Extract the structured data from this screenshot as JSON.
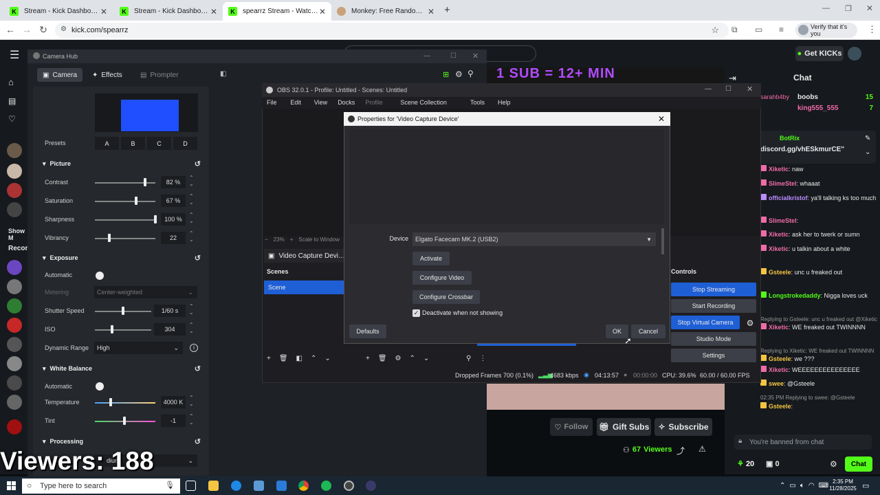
{
  "browser": {
    "tabs": [
      {
        "label": "Stream - Kick Dashboard",
        "active": false
      },
      {
        "label": "Stream - Kick Dashboard",
        "active": false
      },
      {
        "label": "spearrz Stream - Watch Live on",
        "active": true
      },
      {
        "label": "Monkey: Free Random Video C",
        "active": false
      }
    ],
    "url": "kick.com/spearrz",
    "verify_label": "Verify that it's you"
  },
  "kick": {
    "get_kicks": "Get KICKs",
    "sub_banner": "1 SUB = 12+ MIN",
    "chat_title": "Chat",
    "top_gifters": [
      {
        "name": "boobs",
        "count": "15"
      },
      {
        "name": "king555_555",
        "count": "7"
      }
    ],
    "partial_user": "sarahb4by",
    "pinned_user": "BotRix",
    "pinned_text": "discord.gg/vhESkmurCE\"",
    "chat_messages": [
      {
        "user": "Xiketic",
        "text": ": naw",
        "color": "#f06ba8"
      },
      {
        "user": "SlimeStel",
        "text": ": whaaat",
        "color": "#f06ba8"
      },
      {
        "user": "officialkristof",
        "text": ": ya'll talking ks too much",
        "color": "#b98cff"
      },
      {
        "user": "SlimeStel",
        "text": ": ",
        "color": "#f06ba8"
      },
      {
        "user": "Xiketic",
        "text": ": ask her to twerk or sumn",
        "color": "#f06ba8"
      },
      {
        "user": "Xiketic",
        "text": ": u talkin about a white",
        "color": "#f06ba8"
      },
      {
        "user": "Gsteele",
        "text": ": unc u freaked out",
        "color": "#f5c542"
      },
      {
        "user": "Longstrokedaddy",
        "text": ": Nigga loves uck",
        "color": "#53fc18"
      },
      {
        "user": "",
        "text": "Replying to Gsteele: unc u freaked out @Xiketic",
        "color": "#999"
      },
      {
        "user": "Xiketic",
        "text": ": WE freaked out TWINNNN",
        "color": "#f06ba8"
      },
      {
        "user": "",
        "text": "Replying to Xiketic: WE freaked out TWINNNN",
        "color": "#999"
      },
      {
        "user": "Gsteele",
        "text": ": we ???",
        "color": "#f5c542"
      },
      {
        "user": "Xiketic",
        "text": ": WEEEEEEEEEEEEEEE",
        "color": "#f06ba8"
      },
      {
        "user": "swee",
        "text": ": @Gsteele",
        "color": "#f5c542"
      },
      {
        "user": "",
        "text": "02:35 PM  Replying to swee: @Gsteele",
        "color": "#999"
      },
      {
        "user": "Gsteele",
        "text": ":",
        "color": "#f5c542"
      }
    ],
    "time_stamp": "02:35 PM",
    "follow": "Follow",
    "gift_subs": "Gift Subs",
    "subscribe": "Subscribe",
    "viewers_count": "67",
    "viewers_label": "Viewers",
    "banned": "You're banned from chat",
    "kicks_count": "20",
    "subs_count": "0",
    "chat_button": "Chat",
    "overlay_viewers": "Viewers: 188",
    "sidebar_show_more": "Show M",
    "sidebar_recom": "Recom"
  },
  "camhub": {
    "title": "Camera Hub",
    "tabs": {
      "camera": "Camera",
      "effects": "Effects",
      "prompter": "Prompter"
    },
    "presets_label": "Presets",
    "presets": [
      "A",
      "B",
      "C",
      "D"
    ],
    "picture": {
      "title": "Picture",
      "rows": [
        {
          "label": "Contrast",
          "value": "82 %",
          "level": 0.82
        },
        {
          "label": "Saturation",
          "value": "67 %",
          "level": 0.67
        },
        {
          "label": "Sharpness",
          "value": "100 %",
          "level": 1.0
        },
        {
          "label": "Vibrancy",
          "value": "22",
          "level": 0.22
        }
      ]
    },
    "exposure": {
      "title": "Exposure",
      "automatic": "Automatic",
      "metering": "Metering",
      "metering_value": "Center-weighted",
      "shutter_label": "Shutter Speed",
      "shutter_value": "1/60 s",
      "iso_label": "ISO",
      "iso_value": "304",
      "dr_label": "Dynamic Range",
      "dr_value": "High"
    },
    "white_balance": {
      "title": "White Balance",
      "automatic": "Automatic",
      "temp_label": "Temperature",
      "temp_value": "4000 K",
      "tint_label": "Tint",
      "tint_value": "-1"
    },
    "processing": {
      "title": "Processing",
      "partial": "dium"
    }
  },
  "obs": {
    "title": "OBS 32.0.1 - Profile: Untitled - Scenes: Untitled",
    "menu": [
      "File",
      "Edit",
      "View",
      "Docks",
      "Profile",
      "Scene Collection",
      "Tools",
      "Help"
    ],
    "zoom": "23%",
    "scale": "Scale to Window",
    "source": "Video Capture Device",
    "scenes_title": "Scenes",
    "scene_item": "Scene",
    "controls_title": "Controls",
    "controls": [
      "Stop Streaming",
      "Start Recording",
      "Stop Virtual Camera",
      "Studio Mode",
      "Settings"
    ],
    "status": {
      "dropped": "Dropped Frames 700 (0.1%)",
      "kbps": "4683 kbps",
      "stream_time": "04:13:57",
      "rec_time": "00:00:00",
      "cpu": "CPU: 39.6%",
      "fps": "60.00 / 60.00 FPS"
    }
  },
  "dialog": {
    "title": "Properties for 'Video Capture Device'",
    "device_label": "Device",
    "device_value": "Elgato Facecam MK.2 (USB2)",
    "activate": "Activate",
    "configure_video": "Configure Video",
    "configure_crossbar": "Configure Crossbar",
    "deactivate": "Deactivate when not showing",
    "defaults": "Defaults",
    "ok": "OK",
    "cancel": "Cancel"
  },
  "taskbar": {
    "search_placeholder": "Type here to search",
    "time": "2:35 PM",
    "date": "11/28/2025"
  },
  "colors": {
    "kick_green": "#53fc18",
    "obs_blue": "#1f5fd6",
    "sub_purple": "#b04cff"
  }
}
